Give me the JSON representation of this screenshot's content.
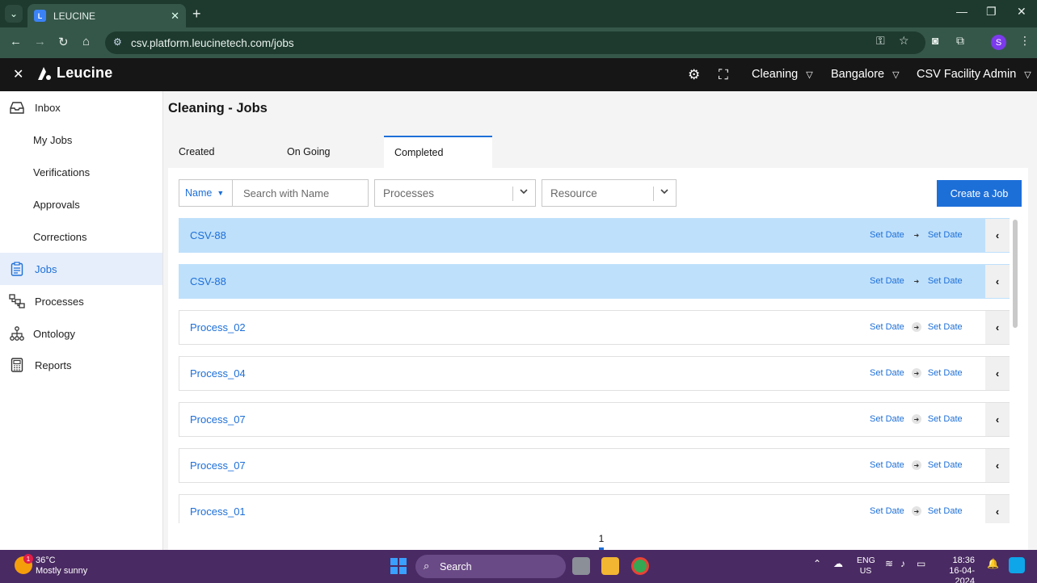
{
  "browser": {
    "tab_title": "LEUCINE",
    "url": "csv.platform.leucinetech.com/jobs",
    "profile_initial": "S"
  },
  "app": {
    "logo_text": "Leucine",
    "facility_selector": "Cleaning",
    "site_selector": "Bangalore",
    "user_menu": "CSV Facility Admin"
  },
  "sidebar": {
    "items": [
      {
        "label": "Inbox",
        "icon": "inbox-icon"
      },
      {
        "label": "My Jobs"
      },
      {
        "label": "Verifications"
      },
      {
        "label": "Approvals"
      },
      {
        "label": "Corrections"
      },
      {
        "label": "Jobs",
        "icon": "clipboard-icon",
        "active": true
      },
      {
        "label": "Processes",
        "icon": "processes-icon"
      },
      {
        "label": "Ontology",
        "icon": "hierarchy-icon"
      },
      {
        "label": "Reports",
        "icon": "reports-icon"
      }
    ]
  },
  "page": {
    "title": "Cleaning - Jobs",
    "tabs": [
      {
        "label": "Created"
      },
      {
        "label": "On Going"
      },
      {
        "label": "Completed",
        "active": true
      }
    ]
  },
  "filters": {
    "field_selector": "Name",
    "search_placeholder": "Search with Name",
    "processes_placeholder": "Processes",
    "resource_placeholder": "Resource",
    "create_button": "Create a Job"
  },
  "jobs": [
    {
      "name": "CSV-88",
      "start": "Set Date",
      "end": "Set Date",
      "highlight": true
    },
    {
      "name": "CSV-88",
      "start": "Set Date",
      "end": "Set Date",
      "highlight": true
    },
    {
      "name": "Process_02",
      "start": "Set Date",
      "end": "Set Date"
    },
    {
      "name": "Process_04",
      "start": "Set Date",
      "end": "Set Date"
    },
    {
      "name": "Process_07",
      "start": "Set Date",
      "end": "Set Date"
    },
    {
      "name": "Process_07",
      "start": "Set Date",
      "end": "Set Date"
    },
    {
      "name": "Process_01",
      "start": "Set Date",
      "end": "Set Date"
    }
  ],
  "pagination": {
    "current_page": "1"
  },
  "taskbar": {
    "weather_temp": "36°C",
    "weather_desc": "Mostly sunny",
    "weather_badge": "1",
    "search_label": "Search",
    "lang_top": "ENG",
    "lang_bottom": "US",
    "time": "18:36",
    "date": "16-04-2024"
  },
  "colors": {
    "accent": "#1d6fd8",
    "highlight_row": "#bfe0fb",
    "app_header": "#161616",
    "browser_chrome": "#35574a",
    "taskbar": "#4a2a63"
  }
}
